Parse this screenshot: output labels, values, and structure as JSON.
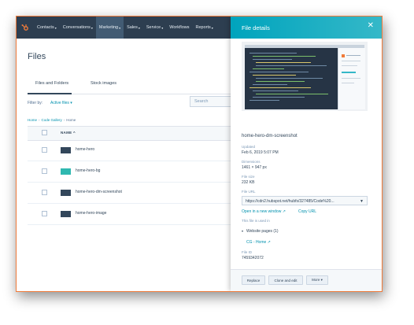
{
  "nav": {
    "items": [
      {
        "label": "Contacts",
        "active": false
      },
      {
        "label": "Conversations",
        "active": false
      },
      {
        "label": "Marketing",
        "active": true
      },
      {
        "label": "Sales",
        "active": false
      },
      {
        "label": "Service",
        "active": false
      },
      {
        "label": "Workflows",
        "active": false
      },
      {
        "label": "Reports",
        "active": false
      }
    ],
    "chevron": "▾"
  },
  "page": {
    "title": "Files",
    "tabs": [
      "Files and Folders",
      "Stock images"
    ],
    "filter_label": "Filter by:",
    "filter_value": "Active files ▾",
    "search_placeholder": "Search",
    "breadcrumb": [
      "Home",
      "Code Gallery",
      "Home"
    ],
    "column_name": "NAME ^"
  },
  "files": [
    {
      "name": "home-hero",
      "thumb": "dark"
    },
    {
      "name": "home-hero-bg",
      "thumb": "teal"
    },
    {
      "name": "home-hero-dm-screenshot",
      "thumb": "dark"
    },
    {
      "name": "home-hero-image",
      "thumb": "dark"
    }
  ],
  "panel": {
    "title": "File details",
    "close_icon": "close-icon",
    "filename": "home-hero-dm-screenshot",
    "updated_label": "Updated",
    "updated_value": "Feb 6, 2019 5:07 PM",
    "dimensions_label": "Dimensions",
    "dimensions_value": "1461 × 947 px",
    "filesize_label": "File size",
    "filesize_value": "232 KB",
    "fileurl_label": "File URL",
    "fileurl_value": "https://cdn2.hubspot.net/hubfs/327485/Code%20...",
    "open_new_window": "Open in a new window",
    "copy_url": "Copy URL",
    "used_in": "This file is used in",
    "website_pages": "Website pages (1)",
    "page_link": "CG - Home",
    "file_id_label": "File ID",
    "file_id_value": "7459342072",
    "buttons": {
      "replace": "Replace",
      "clone_edit": "Clone and edit",
      "more": "More ▾"
    }
  }
}
